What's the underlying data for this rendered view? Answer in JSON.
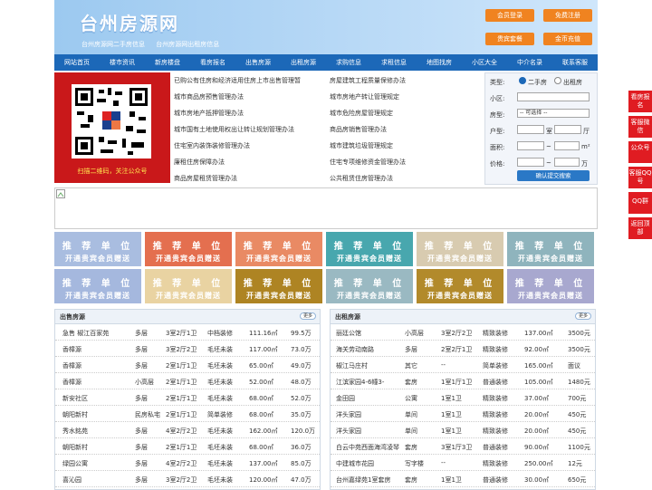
{
  "site": {
    "title": "台州房源网",
    "tag1": "台州房源网二手房信息",
    "tag2": "台州房源网出租房信息"
  },
  "header_buttons": [
    "会员登录",
    "免费注册",
    "贵宾套餐",
    "金币充值"
  ],
  "nav": [
    "网站首页",
    "楼市资讯",
    "新房楼盘",
    "看房报名",
    "出售房源",
    "出租房源",
    "求购信息",
    "求租信息",
    "地图找房",
    "小区大全",
    "中介名录",
    "联系客服"
  ],
  "qr": {
    "caption": "扫描二维码，关注公众号"
  },
  "news_left": [
    "已购公有住房和经济适用住房上市出售管理暂",
    "城市商品房预售管理办法",
    "城市房地产抵押管理办法",
    "城市国有土地使用权出让转让规划管理办法",
    "住宅室内装饰装修管理办法",
    "廉租住房保障办法",
    "商品房屋租赁管理办法"
  ],
  "news_right": [
    "房屋建筑工程质量保修办法",
    "城市房地产转让管理规定",
    "城市危险房屋管理规定",
    "商品房销售管理办法",
    "城市建筑垃圾管理规定",
    "住宅专项维修资金管理办法",
    "公共租赁住房管理办法"
  ],
  "search": {
    "type_label": "类型:",
    "opt1": "二手房",
    "opt2": "出租房",
    "xiaoqu": "小区:",
    "fangxing": "房型:",
    "select": "-- 可选择 --",
    "huxing": "户型:",
    "shi": "室",
    "ting": "厅",
    "area": "面积:",
    "area_unit": "m²",
    "price": "价格:",
    "price_unit": "万",
    "submit": "确认提交搜索"
  },
  "ads": {
    "title": "推 荐 单 位",
    "sub": "开通贵宾会员赠送"
  },
  "ad_colors": [
    "#a9bde0",
    "#e46f4f",
    "#e98a64",
    "#48a7ae",
    "#d8cbb0",
    "#8fb4bd",
    "#a5b8de",
    "#e9d3a2",
    "#ae8423",
    "#9ab9c2",
    "#b28a2b",
    "#a8a8cf"
  ],
  "sale": {
    "title": "出售房源",
    "more": "更多",
    "rows": [
      [
        "急售 椒江百家苑",
        "多层",
        "3室2厅1卫",
        "中档装修",
        "111.16㎡",
        "99.5万"
      ],
      [
        "香樟源",
        "多层",
        "3室2厅2卫",
        "毛坯未装",
        "117.00㎡",
        "73.0万"
      ],
      [
        "香樟源",
        "多层",
        "2室1厅1卫",
        "毛坯未装",
        "65.00㎡",
        "49.0万"
      ],
      [
        "香樟源",
        "小高层",
        "2室1厅1卫",
        "毛坯未装",
        "52.00㎡",
        "48.0万"
      ],
      [
        "新安社区",
        "多层",
        "2室1厅1卫",
        "毛坯未装",
        "68.00㎡",
        "52.0万"
      ],
      [
        "朝阳新村",
        "民房私宅",
        "2室1厅1卫",
        "简单装修",
        "68.00㎡",
        "35.0万"
      ],
      [
        "秀水銘苑",
        "多层",
        "4室2厅2卫",
        "毛坯未装",
        "162.00㎡",
        "120.0万"
      ],
      [
        "朝阳新村",
        "多层",
        "2室1厅1卫",
        "毛坯未装",
        "68.00㎡",
        "36.0万"
      ],
      [
        "绿园公寓",
        "多层",
        "4室2厅2卫",
        "毛坯未装",
        "137.00㎡",
        "85.0万"
      ],
      [
        "喜沁园",
        "多层",
        "3室2厅2卫",
        "毛坯未装",
        "120.00㎡",
        "47.0万"
      ]
    ]
  },
  "rent": {
    "title": "出租房源",
    "more": "更多",
    "rows": [
      [
        "丽廷公馆",
        "小高层",
        "3室2厅2卫",
        "精致装修",
        "137.00㎡",
        "3500元"
      ],
      [
        "海关劳动南路",
        "多层",
        "2室2厅1卫",
        "精致装修",
        "92.00㎡",
        "3500元"
      ],
      [
        "椒江马庄村",
        "其它",
        "--",
        "简单装修",
        "165.00㎡",
        "面议"
      ],
      [
        "江滨家园4-6幢3-",
        "套房",
        "1室1厅1卫",
        "普通装修",
        "105.00㎡",
        "1480元"
      ],
      [
        "金田园",
        "公寓",
        "1室1卫",
        "精致装修",
        "37.00㎡",
        "700元"
      ],
      [
        "洋头家园",
        "单间",
        "1室1卫",
        "精致装修",
        "20.00㎡",
        "450元"
      ],
      [
        "洋头家园",
        "单间",
        "1室1卫",
        "精致装修",
        "20.00㎡",
        "450元"
      ],
      [
        "白云中苑西面海湾凌琴",
        "套房",
        "3室1厅3卫",
        "普通装修",
        "90.00㎡",
        "1100元"
      ],
      [
        "中建城市花园",
        "写字楼",
        "--",
        "精致装修",
        "250.00㎡",
        "12元"
      ],
      [
        "台州嘉绿苑1室套房",
        "套房",
        "1室1卫",
        "普通装修",
        "30.00㎡",
        "650元"
      ]
    ]
  },
  "side": [
    "看房报名",
    "客服微信",
    "公众号",
    "客服QQ号",
    "QQ群",
    "返回顶部"
  ]
}
